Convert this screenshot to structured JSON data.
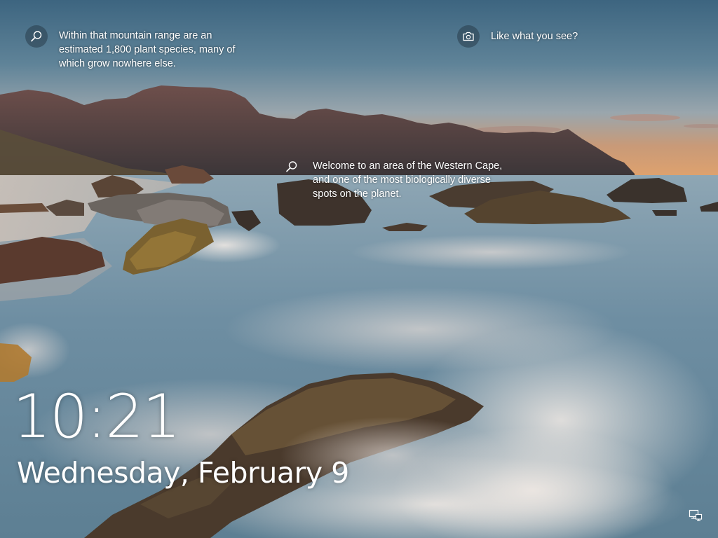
{
  "hotspots": {
    "top_left": {
      "text": "Within that mountain range are an\nestimated 1,800 plant species, many of\nwhich grow nowhere else."
    },
    "top_right": {
      "text": "Like what you see?"
    },
    "center": {
      "text": "Welcome to an area of the Western Cape,\nand one of the most biologically diverse\nspots on the planet."
    }
  },
  "clock": {
    "time": "10:21",
    "date": "Wednesday, February 9"
  },
  "icons": {
    "search": "magnifier-icon",
    "camera": "camera-icon",
    "network": "network-icon"
  },
  "colors": {
    "sky_top": "#3f6682",
    "sky_horizon": "#d99b6a",
    "water": "#6f8fa4",
    "mountains": "#5a4445",
    "rocks": "#4a3a2e",
    "text": "#ffffff"
  }
}
